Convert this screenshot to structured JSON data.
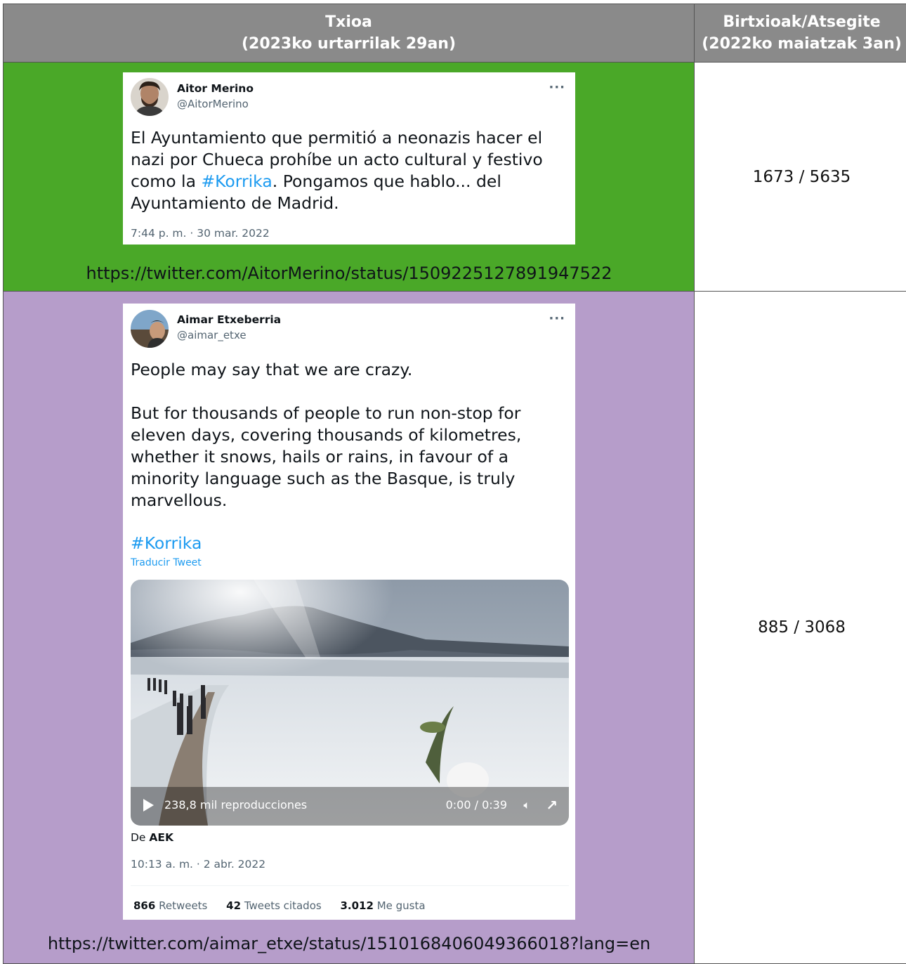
{
  "header": {
    "col1_line1": "Txioa",
    "col1_line2": "(2023ko urtarrilak 29an)",
    "col2_line1": "Birtxioak/Atsegite",
    "col2_line2": "(2022ko maiatzak 3an)"
  },
  "rows": [
    {
      "name": "Aitor Merino",
      "handle": "@AitorMerino",
      "more": "···",
      "text_a": "El Ayuntamiento que permitió a neonazis hacer el nazi por Chueca prohíbe un acto cultural y festivo como la ",
      "hashtag": "#Korrika",
      "text_b": ". Pongamos que hablo... del Ayuntamiento de Madrid.",
      "time": "7:44 p. m. · 30 mar. 2022",
      "url": "https://twitter.com/AitorMerino/status/1509225127891947522",
      "stats": "1673 / 5635",
      "row_color": "#4aa828"
    },
    {
      "name": "Aimar Etxeberria",
      "handle": "@aimar_etxe",
      "more": "···",
      "para1": "People may say that we are crazy.",
      "para2": "But for thousands of people to run non-stop for eleven days, covering thousands of kilometres, whether it snows, hails or rains, in favour of a minority language such as the Basque, is truly marvellous.",
      "hashtag": "#Korrika",
      "translate": "Traducir Tweet",
      "video_views": "238,8 mil reproducciones",
      "video_time": "0:00 / 0:39",
      "from_prefix": "De ",
      "from_name": "AEK",
      "time": "10:13 a. m. · 2 abr. 2022",
      "retweets_num": "866",
      "retweets_label": "Retweets",
      "quotes_num": "42",
      "quotes_label": "Tweets citados",
      "likes_num": "3.012",
      "likes_label": "Me gusta",
      "url": "https://twitter.com/aimar_etxe/status/1510168406049366018?lang=en",
      "stats": "885 / 3068",
      "row_color": "#b69dca"
    }
  ]
}
